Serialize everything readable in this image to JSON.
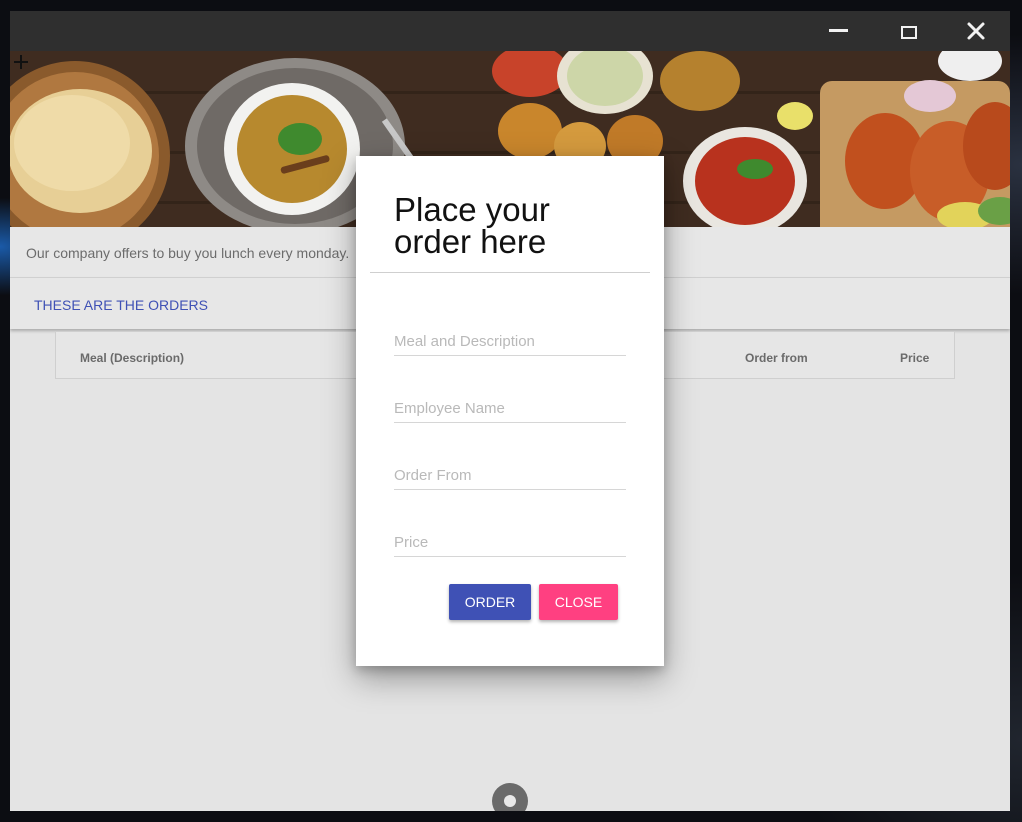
{
  "window": {
    "controls": {
      "minimize_icon": "minimize-icon",
      "maximize_icon": "maximize-icon",
      "close_icon": "close-icon"
    }
  },
  "hero": {
    "image": "indian-food-banner",
    "add_icon": "+"
  },
  "intro": {
    "text": "Our company offers to buy you lunch every monday."
  },
  "orders": {
    "link": "THESE ARE THE ORDERS",
    "columns": [
      "Meal (Description)",
      "Order from",
      "Price"
    ]
  },
  "dialog": {
    "title": "Place your order here",
    "fields": {
      "meal": {
        "placeholder": "Meal and Description"
      },
      "employee": {
        "placeholder": "Employee Name"
      },
      "order_from": {
        "placeholder": "Order From"
      },
      "price": {
        "placeholder": "Price"
      }
    },
    "order_label": "ORDER",
    "close_label": "CLOSE"
  },
  "colors": {
    "primary": "#3f51b5",
    "accent": "#ff4081",
    "titlebar": "#2f2f2f",
    "background": "#e4e4e4"
  }
}
